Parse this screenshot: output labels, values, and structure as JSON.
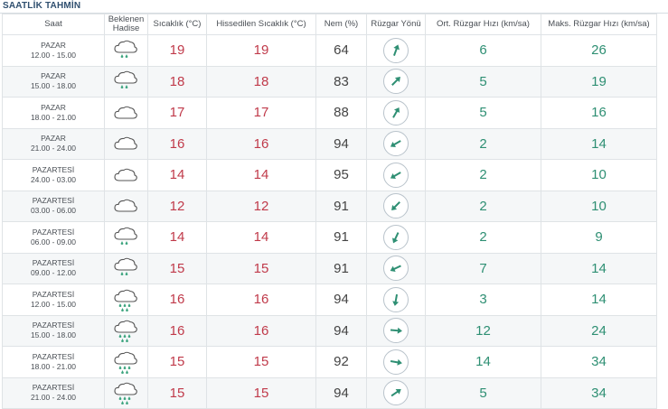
{
  "header": {
    "title": "SAATLİK TAHMİN"
  },
  "columns": {
    "saat": "Saat",
    "hadise": [
      "Beklenen",
      "Hadise"
    ],
    "sicaklik": "Sıcaklık (°C)",
    "hissedilen": "Hissedilen Sıcaklık (°C)",
    "nem": "Nem (%)",
    "yon": "Rüzgar Yönü",
    "ort": "Ort. Rüzgar Hızı (km/sa)",
    "maks": "Maks. Rüzgar Hızı (km/sa)"
  },
  "rows": [
    {
      "day": "PAZAR",
      "time": "12.00 - 15.00",
      "icon": "light-rain-icon",
      "temp": "19",
      "feels": "19",
      "humidity": "64",
      "wind_dir": "wind-north-northeast-icon",
      "wind_deg": 20,
      "avg": "6",
      "max": "26"
    },
    {
      "day": "PAZAR",
      "time": "15.00 - 18.00",
      "icon": "light-rain-icon",
      "temp": "18",
      "feels": "18",
      "humidity": "83",
      "wind_dir": "wind-northeast-icon",
      "wind_deg": 45,
      "avg": "5",
      "max": "19"
    },
    {
      "day": "PAZAR",
      "time": "18.00 - 21.00",
      "icon": "cloudy-icon",
      "temp": "17",
      "feels": "17",
      "humidity": "88",
      "wind_dir": "wind-north-northeast-icon",
      "wind_deg": 30,
      "avg": "5",
      "max": "16"
    },
    {
      "day": "PAZAR",
      "time": "21.00 - 24.00",
      "icon": "cloudy-icon",
      "temp": "16",
      "feels": "16",
      "humidity": "94",
      "wind_dir": "wind-southwest-icon",
      "wind_deg": 240,
      "avg": "2",
      "max": "14"
    },
    {
      "day": "PAZARTESİ",
      "time": "24.00 - 03.00",
      "icon": "cloudy-icon",
      "temp": "14",
      "feels": "14",
      "humidity": "95",
      "wind_dir": "wind-southwest-icon",
      "wind_deg": 240,
      "avg": "2",
      "max": "10"
    },
    {
      "day": "PAZARTESİ",
      "time": "03.00 - 06.00",
      "icon": "cloudy-icon",
      "temp": "12",
      "feels": "12",
      "humidity": "91",
      "wind_dir": "wind-southwest-icon",
      "wind_deg": 225,
      "avg": "2",
      "max": "10"
    },
    {
      "day": "PAZARTESİ",
      "time": "06.00 - 09.00",
      "icon": "light-rain-icon",
      "temp": "14",
      "feels": "14",
      "humidity": "91",
      "wind_dir": "wind-south-southwest-icon",
      "wind_deg": 205,
      "avg": "2",
      "max": "9"
    },
    {
      "day": "PAZARTESİ",
      "time": "09.00 - 12.00",
      "icon": "light-rain-icon",
      "temp": "15",
      "feels": "15",
      "humidity": "91",
      "wind_dir": "wind-southwest-icon",
      "wind_deg": 245,
      "avg": "7",
      "max": "14"
    },
    {
      "day": "PAZARTESİ",
      "time": "12.00 - 15.00",
      "icon": "rain-icon",
      "temp": "16",
      "feels": "16",
      "humidity": "94",
      "wind_dir": "wind-south-icon",
      "wind_deg": 190,
      "avg": "3",
      "max": "14"
    },
    {
      "day": "PAZARTESİ",
      "time": "15.00 - 18.00",
      "icon": "rain-icon",
      "temp": "16",
      "feels": "16",
      "humidity": "94",
      "wind_dir": "wind-east-icon",
      "wind_deg": 95,
      "avg": "12",
      "max": "24"
    },
    {
      "day": "PAZARTESİ",
      "time": "18.00 - 21.00",
      "icon": "rain-icon",
      "temp": "15",
      "feels": "15",
      "humidity": "92",
      "wind_dir": "wind-east-icon",
      "wind_deg": 100,
      "avg": "14",
      "max": "34"
    },
    {
      "day": "PAZARTESİ",
      "time": "21.00 - 24.00",
      "icon": "rain-icon",
      "temp": "15",
      "feels": "15",
      "humidity": "94",
      "wind_dir": "wind-northeast-icon",
      "wind_deg": 55,
      "avg": "5",
      "max": "34"
    }
  ],
  "colors": {
    "temp": "#c03a4a",
    "wind": "#2e8f73",
    "icon_green": "#3aa37d"
  }
}
